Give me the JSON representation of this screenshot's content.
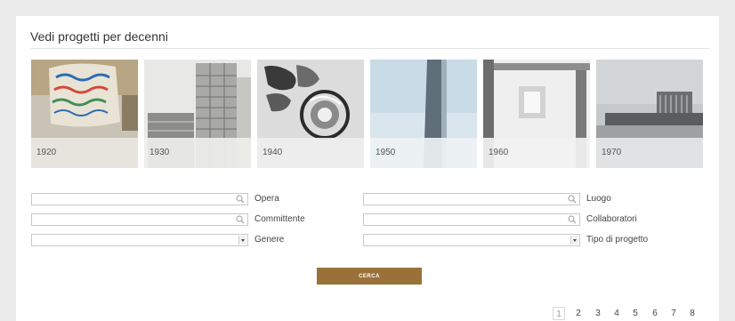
{
  "section_title": "Vedi progetti per decenni",
  "decades": [
    {
      "label": "1920"
    },
    {
      "label": "1930"
    },
    {
      "label": "1940"
    },
    {
      "label": "1950"
    },
    {
      "label": "1960"
    },
    {
      "label": "1970"
    }
  ],
  "filters": {
    "opera": {
      "label": "Opera",
      "value": ""
    },
    "committente": {
      "label": "Committente",
      "value": ""
    },
    "genere": {
      "label": "Genere",
      "selected": ""
    },
    "luogo": {
      "label": "Luogo",
      "value": ""
    },
    "collaboratori": {
      "label": "Collaboratori",
      "value": ""
    },
    "tipo_di_progetto": {
      "label": "Tipo di progetto",
      "selected": ""
    }
  },
  "search_button": {
    "label": "CERCA"
  },
  "pagination": {
    "pages": [
      "1",
      "2",
      "3",
      "4",
      "5",
      "6",
      "7",
      "8"
    ],
    "current": "1"
  },
  "colors": {
    "accent": "#9a7239",
    "background": "#ececec",
    "panel": "#ffffff"
  }
}
